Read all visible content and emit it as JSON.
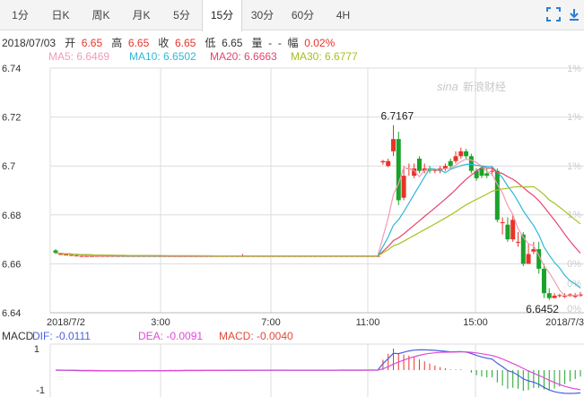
{
  "tabs": [
    {
      "label": "1分",
      "active": false
    },
    {
      "label": "日K",
      "active": false
    },
    {
      "label": "周K",
      "active": false
    },
    {
      "label": "月K",
      "active": false
    },
    {
      "label": "5分",
      "active": false
    },
    {
      "label": "15分",
      "active": true
    },
    {
      "label": "30分",
      "active": false
    },
    {
      "label": "60分",
      "active": false
    },
    {
      "label": "4H",
      "active": false
    }
  ],
  "toolbar": {
    "fullscreen_icon": "fullscreen-icon",
    "download_icon": "download-icon"
  },
  "info": {
    "date": "2018/07/03",
    "open_label": "开",
    "open": "6.65",
    "high_label": "高",
    "high": "6.65",
    "close_label": "收",
    "close": "6.65",
    "low_label": "低",
    "low": "6.65",
    "volume_label": "量",
    "volume": "-",
    "change_label": "幅",
    "change": "0.02%"
  },
  "ma": [
    {
      "label": "MA5: 6.6469",
      "color": "#f29bb6"
    },
    {
      "label": "MA10: 6.6502",
      "color": "#2fb8d6"
    },
    {
      "label": "MA20: 6.6663",
      "color": "#e5436e"
    },
    {
      "label": "MA30: 6.6777",
      "color": "#a3c21c"
    }
  ],
  "watermark": "新浪财经",
  "colors": {
    "up": "#e9332a",
    "down": "#1aa32a",
    "grid": "#dcdcdc"
  },
  "price_axis": {
    "ticks": [
      "6.74",
      "6.72",
      "6.7",
      "6.68",
      "6.66",
      "6.64"
    ],
    "ylim": [
      6.64,
      6.74
    ]
  },
  "pct_axis": {
    "ticks": [
      "1%",
      "1%",
      "1%",
      "1%",
      "0%",
      "0%",
      "0%"
    ]
  },
  "time_axis": {
    "ticks": [
      "2018/7/2",
      "3:00",
      "7:00",
      "11:00",
      "15:00",
      "2018/7/3"
    ]
  },
  "annotations": {
    "high": "6.7167",
    "low": "6.6452"
  },
  "macd": {
    "name": "MACD",
    "dif": "DIF: -0.0111",
    "dea": "DEA: -0.0091",
    "macd": "MACD: -0.0040",
    "dif_color": "#4a5fe0",
    "dea_color": "#e04ad6",
    "macd_color": "#e04a3a",
    "ticks": [
      "1",
      "-1"
    ]
  },
  "chart_data": {
    "type": "candlestick",
    "ylim": [
      6.64,
      6.74
    ],
    "candles": [
      [
        6.6655,
        6.6645,
        6.666,
        6.664
      ],
      [
        6.664,
        6.664,
        6.6642,
        6.6638
      ],
      [
        6.6638,
        6.6638,
        6.664,
        6.6636
      ],
      [
        6.6636,
        6.6636,
        6.6638,
        6.6634
      ],
      [
        6.6634,
        6.6634,
        6.6636,
        6.6632
      ],
      [
        6.6632,
        6.6632,
        6.6634,
        6.663
      ],
      [
        6.6632,
        6.6632,
        6.6634,
        6.663
      ],
      [
        6.6632,
        6.6632,
        6.6634,
        6.663
      ],
      [
        6.6632,
        6.6632,
        6.6634,
        6.663
      ],
      [
        6.6632,
        6.6632,
        6.6634,
        6.663
      ],
      [
        6.6632,
        6.6632,
        6.6634,
        6.663
      ],
      [
        6.6632,
        6.6632,
        6.6634,
        6.663
      ],
      [
        6.6632,
        6.6632,
        6.6634,
        6.663
      ],
      [
        6.6632,
        6.6632,
        6.6634,
        6.663
      ],
      [
        6.6632,
        6.6632,
        6.6634,
        6.663
      ],
      [
        6.6632,
        6.6632,
        6.6634,
        6.663
      ],
      [
        6.6632,
        6.6632,
        6.6634,
        6.663
      ],
      [
        6.6632,
        6.6632,
        6.6634,
        6.663
      ],
      [
        6.6632,
        6.6632,
        6.6634,
        6.663
      ],
      [
        6.6632,
        6.6632,
        6.6634,
        6.663
      ],
      [
        6.6632,
        6.6632,
        6.6634,
        6.663
      ],
      [
        6.6632,
        6.6632,
        6.6634,
        6.663
      ],
      [
        6.6632,
        6.6632,
        6.6634,
        6.663
      ],
      [
        6.6632,
        6.6632,
        6.6634,
        6.663
      ],
      [
        6.6632,
        6.6632,
        6.6634,
        6.663
      ],
      [
        6.6632,
        6.6632,
        6.6634,
        6.663
      ],
      [
        6.6632,
        6.6632,
        6.6634,
        6.663
      ],
      [
        6.6632,
        6.6632,
        6.6634,
        6.663
      ],
      [
        6.6632,
        6.6632,
        6.6634,
        6.663
      ],
      [
        6.6632,
        6.6632,
        6.6634,
        6.663
      ],
      [
        6.6632,
        6.6632,
        6.6634,
        6.663
      ],
      [
        6.6632,
        6.6632,
        6.6634,
        6.663
      ],
      [
        6.6632,
        6.6632,
        6.6634,
        6.663
      ],
      [
        6.6632,
        6.6632,
        6.6634,
        6.663
      ],
      [
        6.6632,
        6.6632,
        6.6634,
        6.663
      ],
      [
        6.6632,
        6.6632,
        6.6634,
        6.663
      ],
      [
        6.6632,
        6.6632,
        6.664,
        6.663
      ],
      [
        6.6632,
        6.6632,
        6.6634,
        6.663
      ],
      [
        6.6632,
        6.6632,
        6.6634,
        6.663
      ],
      [
        6.6632,
        6.6632,
        6.6634,
        6.663
      ],
      [
        6.6632,
        6.6632,
        6.6634,
        6.663
      ],
      [
        6.6632,
        6.6632,
        6.6634,
        6.663
      ],
      [
        6.6632,
        6.6632,
        6.6634,
        6.663
      ],
      [
        6.6632,
        6.6632,
        6.6634,
        6.663
      ],
      [
        6.6632,
        6.6632,
        6.6634,
        6.663
      ],
      [
        6.6632,
        6.6632,
        6.6634,
        6.663
      ],
      [
        6.6632,
        6.6632,
        6.6634,
        6.663
      ],
      [
        6.6632,
        6.6632,
        6.6634,
        6.663
      ],
      [
        6.6632,
        6.6632,
        6.6634,
        6.663
      ],
      [
        6.6632,
        6.6632,
        6.6634,
        6.663
      ],
      [
        6.6632,
        6.6632,
        6.6634,
        6.663
      ],
      [
        6.6632,
        6.6632,
        6.6634,
        6.663
      ],
      [
        6.6632,
        6.6632,
        6.6634,
        6.663
      ],
      [
        6.6632,
        6.6632,
        6.6634,
        6.663
      ],
      [
        6.6632,
        6.6632,
        6.6634,
        6.663
      ],
      [
        6.6632,
        6.6632,
        6.6634,
        6.663
      ],
      [
        6.6632,
        6.6632,
        6.6634,
        6.663
      ],
      [
        6.6632,
        6.6632,
        6.6634,
        6.663
      ],
      [
        6.6632,
        6.6632,
        6.6634,
        6.663
      ],
      [
        6.6632,
        6.6632,
        6.6634,
        6.663
      ],
      [
        6.6632,
        6.6632,
        6.6634,
        6.663
      ],
      [
        6.6632,
        6.6632,
        6.6634,
        6.663
      ],
      [
        6.6632,
        6.6632,
        6.6634,
        6.663
      ],
      [
        6.7015,
        6.702,
        6.7025,
        6.7005
      ],
      [
        6.7,
        6.702,
        6.703,
        6.6995
      ],
      [
        6.706,
        6.711,
        6.7167,
        6.704
      ],
      [
        6.711,
        6.686,
        6.714,
        6.684
      ],
      [
        6.687,
        6.696,
        6.7,
        6.686
      ],
      [
        6.699,
        6.699,
        6.701,
        6.696
      ],
      [
        6.696,
        6.699,
        6.701,
        6.695
      ],
      [
        6.703,
        6.698,
        6.704,
        6.697
      ],
      [
        6.698,
        6.699,
        6.701,
        6.697
      ],
      [
        6.699,
        6.698,
        6.7,
        6.697
      ],
      [
        6.698,
        6.6985,
        6.699,
        6.697
      ],
      [
        6.698,
        6.699,
        6.7,
        6.697
      ],
      [
        6.699,
        6.7,
        6.701,
        6.698
      ],
      [
        6.702,
        6.7,
        6.703,
        6.699
      ],
      [
        6.702,
        6.704,
        6.706,
        6.701
      ],
      [
        6.704,
        6.706,
        6.7075,
        6.703
      ],
      [
        6.706,
        6.704,
        6.707,
        6.703
      ],
      [
        6.704,
        6.698,
        6.705,
        6.697
      ],
      [
        6.698,
        6.695,
        6.699,
        6.694
      ],
      [
        6.699,
        6.696,
        6.7,
        6.695
      ],
      [
        6.697,
        6.696,
        6.699,
        6.695
      ],
      [
        6.698,
        6.698,
        6.7,
        6.696
      ],
      [
        6.698,
        6.678,
        6.699,
        6.677
      ],
      [
        6.677,
        6.677,
        6.679,
        6.672
      ],
      [
        6.676,
        6.67,
        6.679,
        6.669
      ],
      [
        6.67,
        6.678,
        6.68,
        6.669
      ],
      [
        6.669,
        6.669,
        6.673,
        6.667
      ],
      [
        6.672,
        6.66,
        6.673,
        6.659
      ],
      [
        6.66,
        6.664,
        6.668,
        6.66
      ],
      [
        6.665,
        6.666,
        6.669,
        6.664
      ],
      [
        6.666,
        6.658,
        6.669,
        6.656
      ],
      [
        6.658,
        6.648,
        6.66,
        6.646
      ],
      [
        6.648,
        6.646,
        6.65,
        6.6452
      ],
      [
        6.646,
        6.647,
        6.648,
        6.646
      ],
      [
        6.647,
        6.6472,
        6.6478,
        6.6462
      ],
      [
        6.6465,
        6.647,
        6.648,
        6.646
      ],
      [
        6.647,
        6.6475,
        6.648,
        6.6465
      ],
      [
        6.6465,
        6.647,
        6.648,
        6.646
      ],
      [
        6.647,
        6.6475,
        6.6485,
        6.6465
      ]
    ]
  }
}
